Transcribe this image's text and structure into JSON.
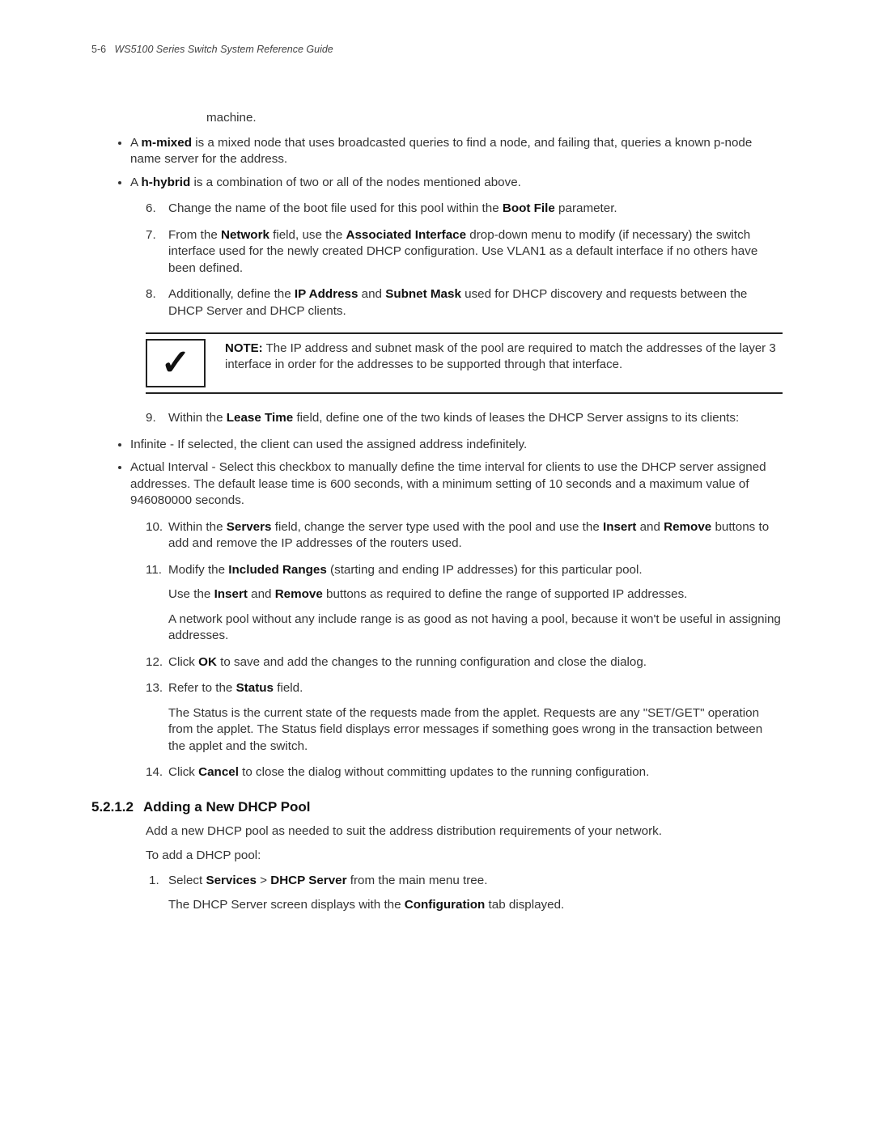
{
  "header": {
    "page_number": "5-6",
    "doc_title": "WS5100 Series Switch System Reference Guide"
  },
  "intro_fragment": "machine.",
  "bullets_top": [
    {
      "pre": "A ",
      "term": "m-mixed",
      "post": " is a mixed node that uses broadcasted queries to find a node, and failing that, queries a known p-node name server for the address."
    },
    {
      "pre": "A ",
      "term": "h-hybrid",
      "post": " is a combination of two or all of the nodes mentioned above."
    }
  ],
  "step6": {
    "pre": "Change the name of the boot file used for this pool within the ",
    "term1": "Boot File",
    "post": " parameter."
  },
  "step7": {
    "p1a": "From the ",
    "t1": "Network",
    "p1b": " field, use the ",
    "t2": "Associated Interface",
    "p1c": " drop-down menu to modify (if necessary) the switch interface used for the newly created DHCP configuration. Use VLAN1 as a default interface if no others have been defined."
  },
  "step8": {
    "p1a": "Additionally, define the ",
    "t1": "IP Address",
    "p1b": " and ",
    "t2": "Subnet Mask",
    "p1c": " used for DHCP discovery and requests between the DHCP Server and DHCP clients."
  },
  "note": {
    "label": "NOTE:",
    "text": " The IP address and subnet mask of the pool are required to match the addresses of the layer 3 interface in order for the addresses to be supported through that interface."
  },
  "step9": {
    "p1a": "Within the ",
    "t1": "Lease Time",
    "p1b": " field, define one of the two kinds of leases the DHCP Server assigns to its clients:"
  },
  "step9_bullets": [
    "Infinite - If selected, the client can used the assigned address indefinitely.",
    "Actual Interval - Select this checkbox to manually define the time interval for clients to use the DHCP server assigned addresses. The default lease time is 600 seconds, with a minimum setting of 10 seconds and a maximum value of 946080000 seconds."
  ],
  "step10": {
    "p1a": "Within the ",
    "t1": "Servers",
    "p1b": " field, change the server type used with the pool and use the ",
    "t2": "Insert",
    "p1c": " and ",
    "t3": "Remove",
    "p1d": " buttons to add and remove the IP addresses of the routers used."
  },
  "step11": {
    "p1a": "Modify the ",
    "t1": "Included Ranges",
    "p1b": " (starting and ending IP addresses) for this particular pool.",
    "p2a": "Use the ",
    "t2": "Insert",
    "p2b": " and ",
    "t3": "Remove",
    "p2c": " buttons as required to define the range of supported IP addresses.",
    "p3": "A network pool without any include range is as good as not having a pool, because it won't be useful in assigning addresses."
  },
  "step12": {
    "p1a": "Click ",
    "t1": "OK",
    "p1b": " to save and add the changes to the running configuration and close the dialog."
  },
  "step13": {
    "p1a": "Refer to the ",
    "t1": "Status",
    "p1b": " field.",
    "p2": "The Status is the current state of the requests made from the applet. Requests are any \"SET/GET\" operation from the applet. The Status field displays error messages if something goes wrong in the transaction between the applet and the switch."
  },
  "step14": {
    "p1a": "Click ",
    "t1": "Cancel",
    "p1b": " to close the dialog without committing updates to the running configuration."
  },
  "section": {
    "number": "5.2.1.2",
    "title": "Adding a New DHCP Pool",
    "intro1": "Add a new DHCP pool as needed to suit the address distribution requirements of your network.",
    "intro2": "To add a DHCP pool:",
    "step1": {
      "p1a": "Select ",
      "t1": "Services",
      "sep": " > ",
      "t2": "DHCP Server",
      "p1b": " from the main menu tree.",
      "p2a": "The DHCP Server screen displays with the ",
      "t3": "Configuration",
      "p2b": " tab displayed."
    }
  }
}
